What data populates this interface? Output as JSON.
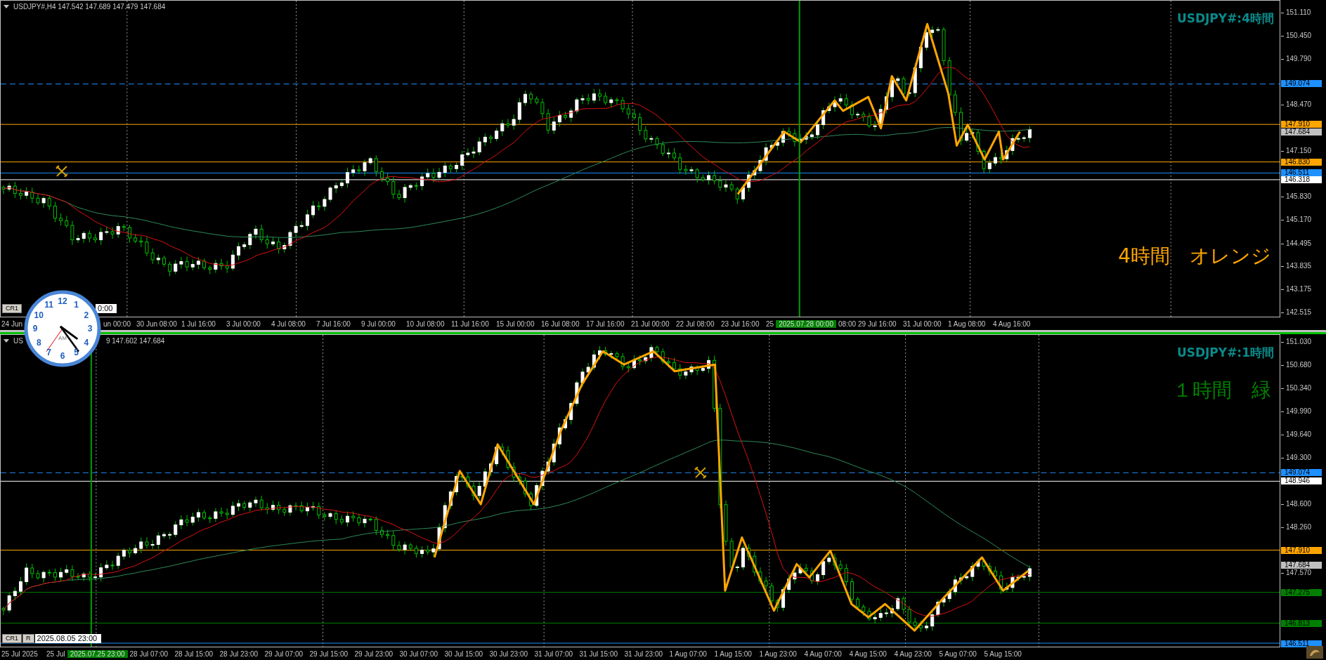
{
  "panels": [
    {
      "header": {
        "fragments": [
          "USDJPY#,H4  147.542 147.689 147.479 147.684"
        ]
      },
      "symbol_label": "USDJPY#:4時間",
      "note": {
        "text": "4時間　オレンジ",
        "color": "#ffa500"
      },
      "price_ticks": [
        "151.110",
        "150.450",
        "149.790",
        "148.470",
        "147.150",
        "145.830",
        "145.170",
        "144.495",
        "143.835",
        "143.175",
        "142.515"
      ],
      "price_tags": [
        {
          "price": "149.074",
          "color": "#1e90ff",
          "kind": "dashed"
        },
        {
          "price": "147.910",
          "color": "#ffa500",
          "kind": "solid"
        },
        {
          "price": "147.684",
          "color": "#c0c0c0",
          "kind": "price"
        },
        {
          "price": "146.830",
          "color": "#ffa500",
          "kind": "solid"
        },
        {
          "price": "146.511",
          "color": "#1e90ff",
          "kind": "solid"
        },
        {
          "price": "146.318",
          "color": "#ffffff",
          "kind": "solid"
        }
      ],
      "toolbar": [
        {
          "kind": "button",
          "text": "CR1"
        },
        {
          "kind": "field",
          "text": "0:00"
        }
      ],
      "time_labels": [
        {
          "text": "24 Jun",
          "kind": "label"
        },
        {
          "text": "un 00:00",
          "kind": "clipped"
        },
        {
          "text": "30 Jun 08:00",
          "kind": "label"
        },
        {
          "text": "1 Jul 16:00",
          "kind": "label"
        },
        {
          "text": "3 Jul 00:00",
          "kind": "label"
        },
        {
          "text": "4 Jul 08:00",
          "kind": "label"
        },
        {
          "text": "7 Jul 16:00",
          "kind": "label"
        },
        {
          "text": "9 Jul 00:00",
          "kind": "label"
        },
        {
          "text": "10 Jul 08:00",
          "kind": "label"
        },
        {
          "text": "11 Jul 16:00",
          "kind": "label"
        },
        {
          "text": "15 Jul 00:00",
          "kind": "label"
        },
        {
          "text": "16 Jul 08:00",
          "kind": "label"
        },
        {
          "text": "17 Jul 16:00",
          "kind": "label"
        },
        {
          "text": "21 Jul 00:00",
          "kind": "label"
        },
        {
          "text": "22 Jul 08:00",
          "kind": "label"
        },
        {
          "text": "23 Jul 16:00",
          "kind": "label"
        },
        {
          "text": "25",
          "kind": "partial"
        },
        {
          "text": "2025.07.28 00:00",
          "kind": "cursor"
        },
        {
          "text": "08:00",
          "kind": "partial"
        },
        {
          "text": "29 Jul 16:00",
          "kind": "label"
        },
        {
          "text": "31 Jul 00:00",
          "kind": "label"
        },
        {
          "text": "1 Aug 08:00",
          "kind": "label"
        },
        {
          "text": "4 Aug 16:00",
          "kind": "label"
        }
      ]
    },
    {
      "header": {
        "fragments": [
          "US",
          "9 147.602 147.684"
        ]
      },
      "symbol_label": "USDJPY#:1時間",
      "note": {
        "text": "１時間　緑",
        "color": "#008000"
      },
      "price_ticks": [
        "151.030",
        "150.680",
        "150.340",
        "149.990",
        "149.640",
        "149.300",
        "148.600",
        "148.260",
        "147.570"
      ],
      "price_tags": [
        {
          "price": "149.074",
          "color": "#1e90ff",
          "kind": "dashed"
        },
        {
          "price": "148.946",
          "color": "#ffffff",
          "kind": "solid"
        },
        {
          "price": "147.910",
          "color": "#ffa500",
          "kind": "solid"
        },
        {
          "price": "147.684",
          "color": "#c0c0c0",
          "kind": "price"
        },
        {
          "price": "147.275",
          "color": "#008000",
          "kind": "solid"
        },
        {
          "price": "146.813",
          "color": "#008000",
          "kind": "solid"
        },
        {
          "price": "146.511",
          "color": "#1e90ff",
          "kind": "solid"
        }
      ],
      "toolbar": [
        {
          "kind": "button",
          "text": "CR1"
        },
        {
          "kind": "button",
          "text": "R"
        },
        {
          "kind": "field",
          "text": "2025.08.05 23:00"
        }
      ],
      "time_labels": [
        {
          "text": "25 Jul 2025",
          "kind": "label"
        },
        {
          "text": "25 Jul",
          "kind": "partial"
        },
        {
          "text": "2025.07.25 23:00",
          "kind": "cursor"
        },
        {
          "text": "28 Jul 07:00",
          "kind": "label"
        },
        {
          "text": "28 Jul 15:00",
          "kind": "label"
        },
        {
          "text": "28 Jul 23:00",
          "kind": "label"
        },
        {
          "text": "29 Jul 07:00",
          "kind": "label"
        },
        {
          "text": "29 Jul 15:00",
          "kind": "label"
        },
        {
          "text": "29 Jul 23:00",
          "kind": "label"
        },
        {
          "text": "30 Jul 07:00",
          "kind": "label"
        },
        {
          "text": "30 Jul 15:00",
          "kind": "label"
        },
        {
          "text": "30 Jul 23:00",
          "kind": "label"
        },
        {
          "text": "31 Jul 07:00",
          "kind": "label"
        },
        {
          "text": "31 Jul 15:00",
          "kind": "label"
        },
        {
          "text": "31 Jul 23:00",
          "kind": "label"
        },
        {
          "text": "1 Aug 07:00",
          "kind": "label"
        },
        {
          "text": "1 Aug 15:00",
          "kind": "label"
        },
        {
          "text": "1 Aug 23:00",
          "kind": "label"
        },
        {
          "text": "4 Aug 07:00",
          "kind": "label"
        },
        {
          "text": "4 Aug 15:00",
          "kind": "label"
        },
        {
          "text": "4 Aug 23:00",
          "kind": "label"
        },
        {
          "text": "5 Aug 07:00",
          "kind": "label"
        },
        {
          "text": "5 Aug 15:00",
          "kind": "label"
        }
      ]
    }
  ],
  "clock": {
    "numerals": [
      "12",
      "11",
      "1",
      "10",
      "2",
      "9",
      "3",
      "8",
      "4",
      "7",
      "5",
      "6"
    ],
    "period": "AM"
  }
}
